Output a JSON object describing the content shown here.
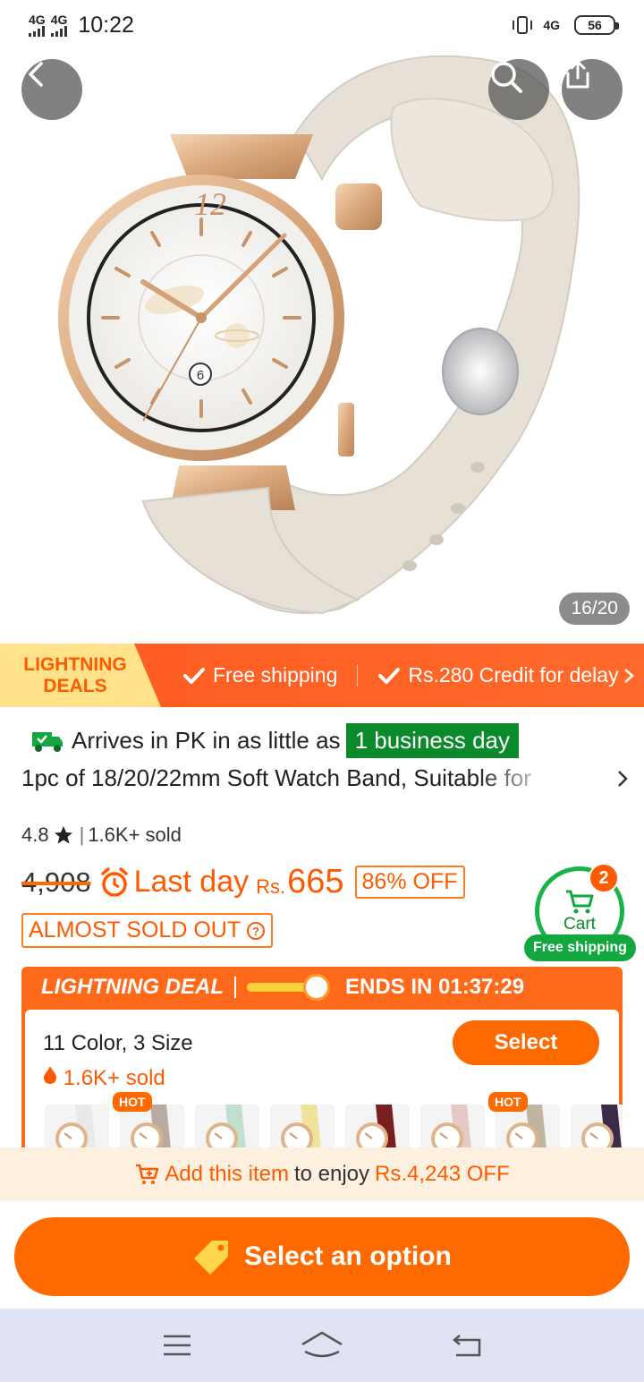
{
  "status_bar": {
    "net1": "4G",
    "net2": "4G",
    "time": "10:22",
    "net3": "4G",
    "battery": "56"
  },
  "hero": {
    "image_counter": "16/20"
  },
  "icons": {
    "back": "back-arrow-icon",
    "search": "search-icon",
    "share": "share-icon",
    "truck": "delivery-truck-icon",
    "star": "star-icon",
    "alarm": "alarm-clock-icon",
    "question": "question-circle-icon",
    "cart": "cart-icon",
    "tag": "tag-icon"
  },
  "colors": {
    "accent": "#ff6a00",
    "green": "#0a8a2a"
  },
  "lightning_banner": {
    "title_line1": "LIGHTNING",
    "title_line2": "DEALS",
    "item1": "Free shipping",
    "item2": "Rs.280 Credit for delay"
  },
  "product": {
    "arrives_prefix": "Arrives in PK in as little as",
    "arrives_highlight": "1 business day",
    "title": "1pc of 18/20/22mm Soft Watch Band, Suitable for",
    "rating": "4.8",
    "sold": "1.6K+ sold",
    "original_price": "4,908",
    "last_day": "Last day",
    "currency": "Rs.",
    "price": "665",
    "discount": "86% OFF",
    "almost_sold_out": "ALMOST SOLD OUT"
  },
  "cart": {
    "count": "2",
    "label": "Cart",
    "free_shipping": "Free shipping"
  },
  "deal": {
    "label": "LIGHTNING DEAL",
    "ends_in": "ENDS IN 01:37:29",
    "progress": 0.85,
    "options_title": "11 Color, 3 Size",
    "sold": "1.6K+ sold",
    "select_button": "Select",
    "hot_badge": "HOT",
    "thumb_colors": [
      "#e9e9e9",
      "#b9aba3",
      "#bfe0cc",
      "#efe29a",
      "#7a1f1f",
      "#e6c9c6",
      "#bfb5a0",
      "#3b2a48"
    ]
  },
  "promo": {
    "highlight": "Add this item",
    "middle": "to enjoy",
    "amount": "Rs.4,243 OFF"
  },
  "bottom": {
    "cta": "Select an option"
  }
}
